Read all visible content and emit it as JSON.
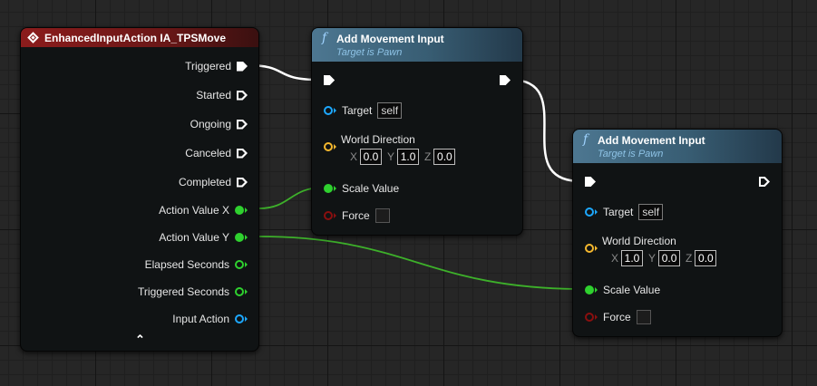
{
  "event_node": {
    "title": "EnhancedInputAction IA_TPSMove",
    "outputs": [
      {
        "label": "Triggered",
        "pin": "exec"
      },
      {
        "label": "Started",
        "pin": "exec"
      },
      {
        "label": "Ongoing",
        "pin": "exec"
      },
      {
        "label": "Canceled",
        "pin": "exec"
      },
      {
        "label": "Completed",
        "pin": "exec"
      },
      {
        "label": "Action Value X",
        "pin": "float"
      },
      {
        "label": "Action Value Y",
        "pin": "float"
      },
      {
        "label": "Elapsed Seconds",
        "pin": "float"
      },
      {
        "label": "Triggered Seconds",
        "pin": "float"
      },
      {
        "label": "Input Action",
        "pin": "object"
      }
    ]
  },
  "move_node_1": {
    "title": "Add Movement Input",
    "subtitle": "Target is Pawn",
    "target_label": "Target",
    "target_value": "self",
    "world_direction_label": "World Direction",
    "x_label": "X",
    "x_value": "0.0",
    "y_label": "Y",
    "y_value": "1.0",
    "z_label": "Z",
    "z_value": "0.0",
    "scale_label": "Scale Value",
    "force_label": "Force"
  },
  "move_node_2": {
    "title": "Add Movement Input",
    "subtitle": "Target is Pawn",
    "target_label": "Target",
    "target_value": "self",
    "world_direction_label": "World Direction",
    "x_label": "X",
    "x_value": "1.0",
    "y_label": "Y",
    "y_value": "0.0",
    "z_label": "Z",
    "z_value": "0.0",
    "scale_label": "Scale Value",
    "force_label": "Force"
  },
  "icons": {
    "function": "f",
    "collapse": "⌃"
  },
  "colors": {
    "float_pin": "#2fd12f",
    "object_pin": "#1da8ff",
    "vector_pin": "#f5b82e",
    "bool_pin": "#8a0f0f",
    "exec_wire": "#ffffff",
    "float_wire": "#3db02a",
    "event_header": "#8b1c1c",
    "function_header": "#4d7791"
  }
}
